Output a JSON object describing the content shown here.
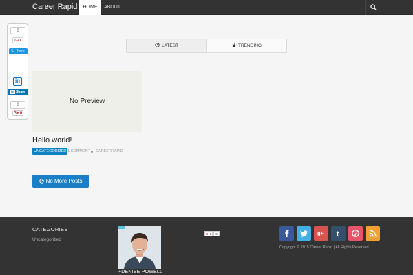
{
  "navbar": {
    "brand": "Career Rapid",
    "items": [
      {
        "label": "HOME",
        "active": true
      },
      {
        "label": "ABOUT",
        "active": false
      }
    ],
    "search_icon": "search-icon"
  },
  "share": {
    "gplus_count": "0",
    "gplus_label": "G+1",
    "tweet_label": "Tweet",
    "linkedin_logo": "in",
    "linkedin_label": "Share",
    "pinterest_count": "0",
    "pinterest_label": "Pin it"
  },
  "tabs": [
    {
      "label": "LATEST",
      "icon": "clock-icon",
      "active": true
    },
    {
      "label": "TRENDING",
      "icon": "fire-icon",
      "active": false
    }
  ],
  "post": {
    "preview_text": "No Preview",
    "title": "Hello world!",
    "category": "UNCATEGORIZED",
    "comments": "1 COMMENT",
    "author": "CAREERRAPID"
  },
  "load_more": {
    "label": "No More Posts",
    "icon": "ban-icon"
  },
  "footer": {
    "categories_heading": "CATEGORIES",
    "category_link": "Uncategorized",
    "profile_name": "+DENISE POWELL",
    "gplus_label": "G+1",
    "gplus_count": "0",
    "social": [
      {
        "name": "facebook",
        "color": "#3b5998",
        "icon": "facebook-icon"
      },
      {
        "name": "twitter",
        "color": "#45b0e3",
        "icon": "twitter-icon"
      },
      {
        "name": "google-plus",
        "color": "#d9534f",
        "icon": "google-plus-icon"
      },
      {
        "name": "tumblr",
        "color": "#35506b",
        "icon": "tumblr-icon"
      },
      {
        "name": "pinterest",
        "color": "#e6556a",
        "icon": "pinterest-icon"
      },
      {
        "name": "rss",
        "color": "#f2a033",
        "icon": "rss-icon"
      }
    ],
    "copyright": "Copyright © 2015 Career Rapid | All Rights Reserved."
  },
  "colors": {
    "navbar_bg": "#333333",
    "accent": "#1a7fc6",
    "footer_bg": "#333333",
    "page_bg": "#f5f5f5"
  }
}
